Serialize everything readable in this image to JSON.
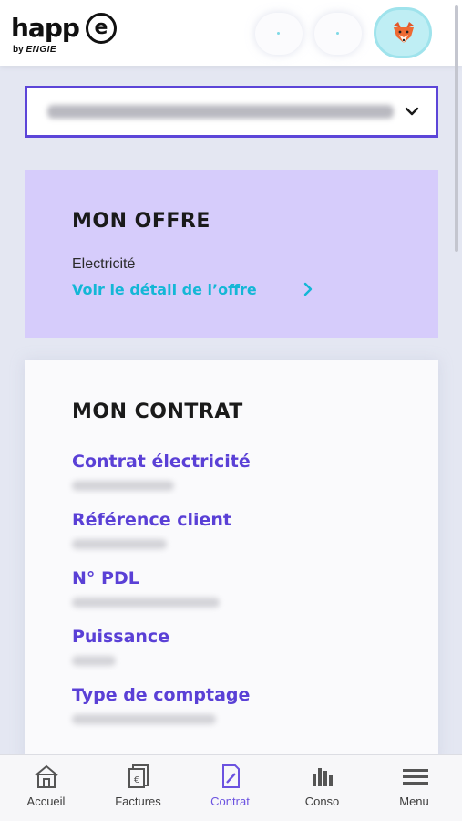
{
  "header": {
    "logo_main": "happ",
    "logo_e": "e",
    "logo_by": "by",
    "logo_brand": "ENGIE",
    "avatar_icon": "fox-avatar-icon"
  },
  "address_select": {
    "value_redacted": true,
    "icon": "chevron-down-icon"
  },
  "offer": {
    "title": "MON OFFRE",
    "energy_type": "Electricité",
    "link_label": "Voir le détail de l’offre"
  },
  "contract": {
    "title": "MON CONTRAT",
    "fields": [
      {
        "label": "Contrat électricité"
      },
      {
        "label": "Référence client"
      },
      {
        "label": "N° PDL"
      },
      {
        "label": "Puissance"
      },
      {
        "label": "Type de comptage"
      }
    ]
  },
  "bottom_nav": {
    "items": [
      {
        "label": "Accueil",
        "icon": "home-icon"
      },
      {
        "label": "Factures",
        "icon": "invoices-icon"
      },
      {
        "label": "Contrat",
        "icon": "contract-icon",
        "active": true
      },
      {
        "label": "Conso",
        "icon": "bar-chart-icon"
      },
      {
        "label": "Menu",
        "icon": "menu-icon"
      }
    ]
  },
  "colors": {
    "accent": "#5c45d8",
    "offer_bg": "#d6ccfb",
    "link": "#14b7d6",
    "page_bg": "#e4e7f2"
  }
}
